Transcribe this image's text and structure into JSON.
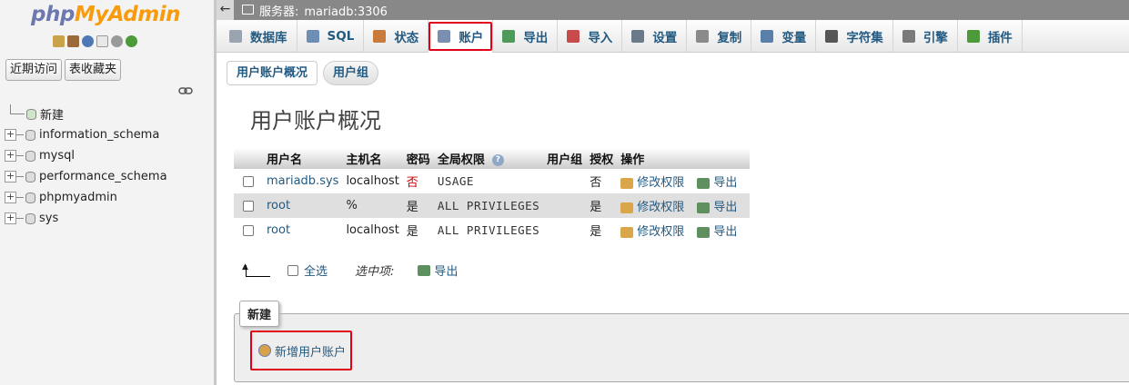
{
  "sidebar": {
    "logo_php": "php",
    "logo_myadmin": "MyAdmin",
    "buttons": [
      "近期访问",
      "表收藏夹"
    ],
    "tree": [
      {
        "label": "新建"
      },
      {
        "label": "information_schema"
      },
      {
        "label": "mysql"
      },
      {
        "label": "performance_schema"
      },
      {
        "label": "phpmyadmin"
      },
      {
        "label": "sys"
      }
    ]
  },
  "serverbar": {
    "label": "服务器:",
    "value": "mariadb:3306"
  },
  "topmenu": [
    {
      "label": "数据库",
      "icon": "database-icon",
      "color": "#9aa3b0"
    },
    {
      "label": "SQL",
      "icon": "sql-icon",
      "color": "#6e8fb5"
    },
    {
      "label": "状态",
      "icon": "status-icon",
      "color": "#c97b3b"
    },
    {
      "label": "账户",
      "icon": "accounts-icon",
      "color": "#7b8fb3",
      "active": true
    },
    {
      "label": "导出",
      "icon": "export-icon",
      "color": "#4e9a5a"
    },
    {
      "label": "导入",
      "icon": "import-icon",
      "color": "#c74b4b"
    },
    {
      "label": "设置",
      "icon": "wrench-icon",
      "color": "#6a7a8a"
    },
    {
      "label": "复制",
      "icon": "replication-icon",
      "color": "#8a8a8a"
    },
    {
      "label": "变量",
      "icon": "variables-icon",
      "color": "#5a7fa8"
    },
    {
      "label": "字符集",
      "icon": "charset-icon",
      "color": "#555555"
    },
    {
      "label": "引擎",
      "icon": "engine-icon",
      "color": "#7a7a7a"
    },
    {
      "label": "插件",
      "icon": "plugin-icon",
      "color": "#4c9a3a"
    }
  ],
  "subtabs": [
    "用户账户概况",
    "用户组"
  ],
  "page_title": "用户账户概况",
  "table": {
    "headers": [
      "用户名",
      "主机名",
      "密码",
      "全局权限",
      "用户组",
      "授权",
      "操作"
    ],
    "rows": [
      {
        "user": "mariadb.sys",
        "host": "localhost",
        "password": "否",
        "privileges": "USAGE",
        "group": "",
        "grant": "否",
        "edit": "修改权限",
        "export": "导出"
      },
      {
        "user": "root",
        "host": "%",
        "password": "是",
        "privileges": "ALL PRIVILEGES",
        "group": "",
        "grant": "是",
        "edit": "修改权限",
        "export": "导出"
      },
      {
        "user": "root",
        "host": "localhost",
        "password": "是",
        "privileges": "ALL PRIVILEGES",
        "group": "",
        "grant": "是",
        "edit": "修改权限",
        "export": "导出"
      }
    ]
  },
  "with_selected": {
    "check_all": "全选",
    "label": "选中项:",
    "export": "导出"
  },
  "new_section": {
    "legend": "新建",
    "add_user": "新增用户账户"
  }
}
